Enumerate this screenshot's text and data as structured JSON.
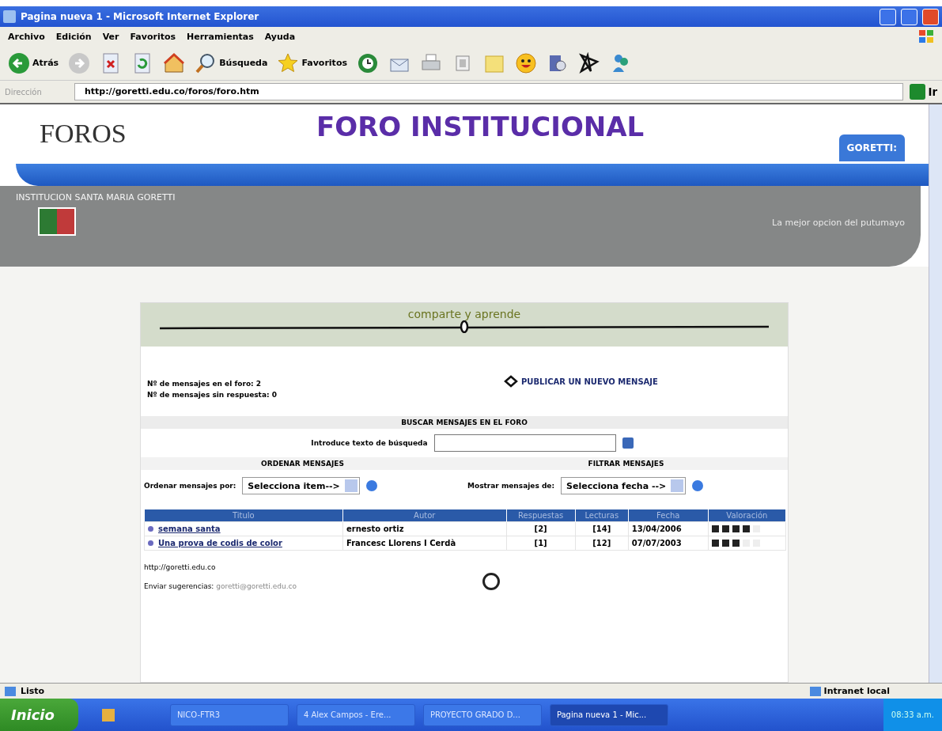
{
  "window": {
    "title": "Pagina nueva 1 - Microsoft Internet Explorer"
  },
  "menu": [
    "Archivo",
    "Edición",
    "Ver",
    "Favoritos",
    "Herramientas",
    "Ayuda"
  ],
  "toolbar": [
    {
      "kind": "back",
      "label": "Atrás"
    },
    {
      "kind": "forward"
    },
    {
      "kind": "stop"
    },
    {
      "kind": "refresh"
    },
    {
      "kind": "home"
    },
    {
      "kind": "search",
      "label": "Búsqueda"
    },
    {
      "kind": "favorites",
      "label": "Favoritos"
    },
    {
      "kind": "history"
    },
    {
      "kind": "mail"
    },
    {
      "kind": "print"
    },
    {
      "kind": "edit"
    },
    {
      "kind": "folder"
    },
    {
      "kind": "smiley"
    },
    {
      "kind": "media"
    },
    {
      "kind": "star"
    },
    {
      "kind": "messenger"
    }
  ],
  "address": {
    "label": "Dirección",
    "value": "http://goretti.edu.co/foros/foro.htm",
    "go": "Ir"
  },
  "header": {
    "logo": "FOROS",
    "title": "FORO INSTITUCIONAL",
    "tab": "GORETTI:",
    "institution": "INSTITUCION SANTA MARIA GORETTI",
    "slogan": "La mejor opcion del putumayo"
  },
  "forum": {
    "banner": "comparte y aprende",
    "stats": [
      "Nº de mensajes en el foro: 2",
      "Nº de mensajes sin respuesta: 0"
    ],
    "publish": "PUBLICAR UN NUEVO MENSAJE",
    "search": {
      "heading": "BUSCAR MENSAJES EN EL FORO",
      "label": "Introduce texto de búsqueda"
    },
    "sort": {
      "heading": "ORDENAR MENSAJES",
      "label": "Ordenar mensajes por:",
      "value": "Selecciona item-->"
    },
    "filter": {
      "heading": "FILTRAR MENSAJES",
      "label": "Mostrar mensajes de:",
      "value": "Selecciona fecha -->"
    },
    "table": {
      "columns": [
        "Titulo",
        "Autor",
        "Respuestas",
        "Lecturas",
        "Fecha",
        "Valoración"
      ],
      "rows": [
        {
          "title": "semana santa",
          "author": "ernesto ortiz",
          "replies": "[2]",
          "reads": "[14]",
          "date": "13/04/2006",
          "stars": 4
        },
        {
          "title": "Una prova de codis de color",
          "author": "Francesc Llorens I Cerdà",
          "replies": "[1]",
          "reads": "[12]",
          "date": "07/07/2003",
          "stars": 3
        }
      ]
    },
    "footer": {
      "url": "http://goretti.edu.co",
      "suggest": "Enviar sugerencias:",
      "email": "goretti@goretti.edu.co"
    }
  },
  "status_bar": {
    "text": "Listo",
    "zone": "Intranet local"
  },
  "taskbar": {
    "start": "Inicio",
    "tasks": [
      {
        "label": "NICO-FTR3",
        "selected": false
      },
      {
        "label": "4 Alex Campos - Ere...",
        "selected": false
      },
      {
        "label": "PROYECTO GRADO D...",
        "selected": false
      },
      {
        "label": "Pagina nueva 1 - Mic...",
        "selected": true
      }
    ],
    "clock": "08:33 a.m."
  }
}
